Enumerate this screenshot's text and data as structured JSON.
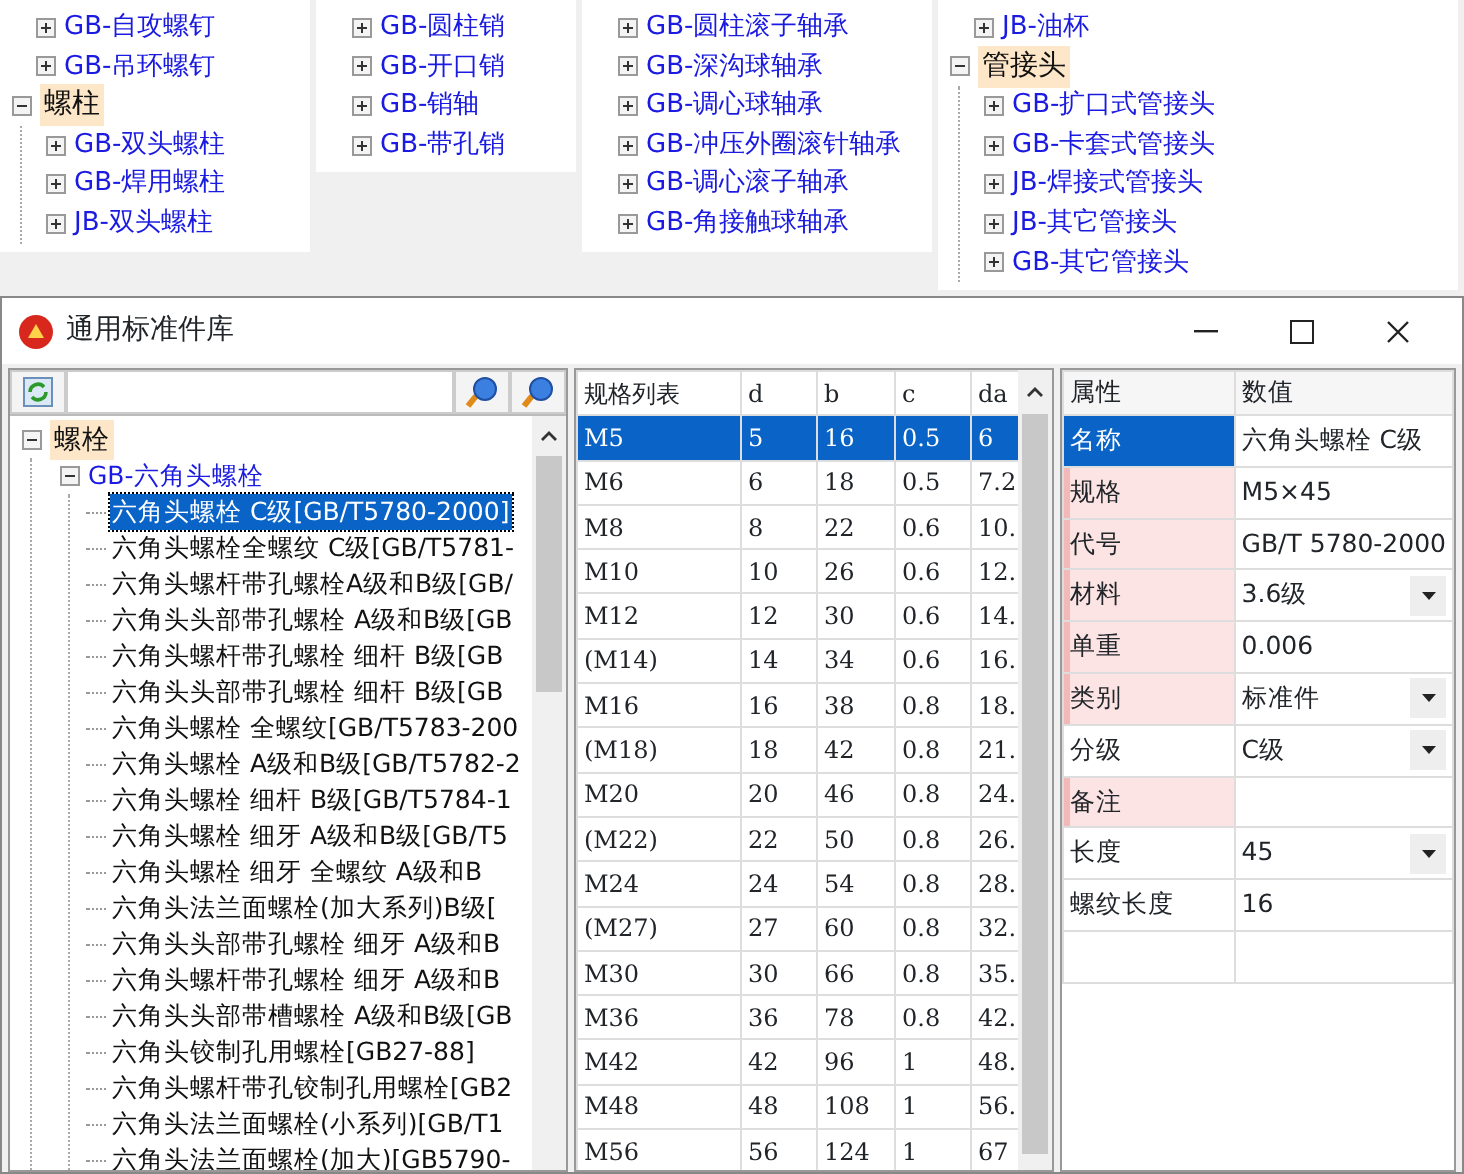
{
  "upper_trees": [
    {
      "items": [
        {
          "kind": "node",
          "label": "GB-自攻螺钉",
          "expanded": false
        },
        {
          "kind": "node",
          "label": "GB-吊环螺钉",
          "expanded": false
        },
        {
          "kind": "category",
          "label": "螺柱",
          "expanded": true,
          "children": [
            {
              "kind": "node",
              "label": "GB-双头螺柱",
              "expanded": false
            },
            {
              "kind": "node",
              "label": "GB-焊用螺柱",
              "expanded": false
            },
            {
              "kind": "node",
              "label": "JB-双头螺柱",
              "expanded": false
            }
          ]
        }
      ]
    },
    {
      "items": [
        {
          "kind": "node",
          "label": "GB-圆柱销",
          "expanded": false
        },
        {
          "kind": "node",
          "label": "GB-开口销",
          "expanded": false
        },
        {
          "kind": "node",
          "label": "GB-销轴",
          "expanded": false
        },
        {
          "kind": "node",
          "label": "GB-带孔销",
          "expanded": false
        }
      ]
    },
    {
      "items": [
        {
          "kind": "node",
          "label": "GB-圆柱滚子轴承",
          "expanded": false
        },
        {
          "kind": "node",
          "label": "GB-深沟球轴承",
          "expanded": false
        },
        {
          "kind": "node",
          "label": "GB-调心球轴承",
          "expanded": false
        },
        {
          "kind": "node",
          "label": "GB-冲压外圈滚针轴承",
          "expanded": false
        },
        {
          "kind": "node",
          "label": "GB-调心滚子轴承",
          "expanded": false
        },
        {
          "kind": "node",
          "label": "GB-角接触球轴承",
          "expanded": false
        }
      ]
    },
    {
      "items": [
        {
          "kind": "node",
          "label": "JB-油杯",
          "expanded": false
        },
        {
          "kind": "category",
          "label": "管接头",
          "expanded": true,
          "children": [
            {
              "kind": "node",
              "label": "GB-扩口式管接头",
              "expanded": false
            },
            {
              "kind": "node",
              "label": "GB-卡套式管接头",
              "expanded": false
            },
            {
              "kind": "node",
              "label": "JB-焊接式管接头",
              "expanded": false
            },
            {
              "kind": "node",
              "label": "JB-其它管接头",
              "expanded": false
            },
            {
              "kind": "node",
              "label": "GB-其它管接头",
              "expanded": false
            }
          ]
        }
      ]
    }
  ],
  "window": {
    "title": "通用标准件库"
  },
  "tree": {
    "items": [
      {
        "kind": "category",
        "label": "螺栓",
        "expanded": true,
        "children": [
          {
            "kind": "node",
            "label": "GB-六角头螺栓",
            "expanded": true,
            "children": [
              {
                "kind": "leaf",
                "label": "六角头螺栓 C级[GB/T5780-2000]",
                "selected": true
              },
              {
                "kind": "leaf",
                "label": "六角头螺栓全螺纹 C级[GB/T5781-",
                "selected": false
              },
              {
                "kind": "leaf",
                "label": "六角头螺杆带孔螺栓A级和B级[GB/",
                "selected": false
              },
              {
                "kind": "leaf",
                "label": "六角头头部带孔螺栓 A级和B级[GB",
                "selected": false
              },
              {
                "kind": "leaf",
                "label": "六角头螺杆带孔螺栓 细杆 B级[GB",
                "selected": false
              },
              {
                "kind": "leaf",
                "label": "六角头头部带孔螺栓 细杆 B级[GB",
                "selected": false
              },
              {
                "kind": "leaf",
                "label": "六角头螺栓 全螺纹[GB/T5783-200",
                "selected": false
              },
              {
                "kind": "leaf",
                "label": "六角头螺栓 A级和B级[GB/T5782-2",
                "selected": false
              },
              {
                "kind": "leaf",
                "label": "六角头螺栓 细杆 B级[GB/T5784-1",
                "selected": false
              },
              {
                "kind": "leaf",
                "label": "六角头螺栓 细牙 A级和B级[GB/T5",
                "selected": false
              },
              {
                "kind": "leaf",
                "label": "六角头螺栓 细牙 全螺纹 A级和B",
                "selected": false
              },
              {
                "kind": "leaf",
                "label": "六角头法兰面螺栓(加大系列)B级[",
                "selected": false
              },
              {
                "kind": "leaf",
                "label": "六角头头部带孔螺栓 细牙 A级和B",
                "selected": false
              },
              {
                "kind": "leaf",
                "label": "六角头螺杆带孔螺栓 细牙 A级和B",
                "selected": false
              },
              {
                "kind": "leaf",
                "label": "六角头头部带槽螺栓 A级和B级[GB",
                "selected": false
              },
              {
                "kind": "leaf",
                "label": "六角头铰制孔用螺栓[GB27-88]",
                "selected": false
              },
              {
                "kind": "leaf",
                "label": "六角头螺杆带孔铰制孔用螺栓[GB2",
                "selected": false
              },
              {
                "kind": "leaf",
                "label": "六角头法兰面螺栓(小系列)[GB/T1",
                "selected": false
              },
              {
                "kind": "leaf",
                "label": "六角头法兰面螺栓(加大)[GB5790-",
                "selected": false
              }
            ]
          }
        ]
      }
    ]
  },
  "spec_table": {
    "columns": [
      "规格列表",
      "d",
      "b",
      "c",
      "da"
    ],
    "rows": [
      {
        "cells": [
          "M5",
          "5",
          "16",
          "0.5",
          "6"
        ],
        "selected": true
      },
      {
        "cells": [
          "M6",
          "6",
          "18",
          "0.5",
          "7.2"
        ],
        "selected": false
      },
      {
        "cells": [
          "M8",
          "8",
          "22",
          "0.6",
          "10."
        ],
        "selected": false
      },
      {
        "cells": [
          "M10",
          "10",
          "26",
          "0.6",
          "12."
        ],
        "selected": false
      },
      {
        "cells": [
          "M12",
          "12",
          "30",
          "0.6",
          "14."
        ],
        "selected": false
      },
      {
        "cells": [
          "(M14)",
          "14",
          "34",
          "0.6",
          "16."
        ],
        "selected": false
      },
      {
        "cells": [
          "M16",
          "16",
          "38",
          "0.8",
          "18."
        ],
        "selected": false
      },
      {
        "cells": [
          "(M18)",
          "18",
          "42",
          "0.8",
          "21."
        ],
        "selected": false
      },
      {
        "cells": [
          "M20",
          "20",
          "46",
          "0.8",
          "24."
        ],
        "selected": false
      },
      {
        "cells": [
          "(M22)",
          "22",
          "50",
          "0.8",
          "26."
        ],
        "selected": false
      },
      {
        "cells": [
          "M24",
          "24",
          "54",
          "0.8",
          "28."
        ],
        "selected": false
      },
      {
        "cells": [
          "(M27)",
          "27",
          "60",
          "0.8",
          "32."
        ],
        "selected": false
      },
      {
        "cells": [
          "M30",
          "30",
          "66",
          "0.8",
          "35."
        ],
        "selected": false
      },
      {
        "cells": [
          "M36",
          "36",
          "78",
          "0.8",
          "42."
        ],
        "selected": false
      },
      {
        "cells": [
          "M42",
          "42",
          "96",
          "1",
          "48."
        ],
        "selected": false
      },
      {
        "cells": [
          "M48",
          "48",
          "108",
          "1",
          "56."
        ],
        "selected": false
      },
      {
        "cells": [
          "M56",
          "56",
          "124",
          "1",
          "67"
        ],
        "selected": false
      }
    ]
  },
  "properties": {
    "columns": [
      "属性",
      "数值"
    ],
    "rows": [
      {
        "name": "名称",
        "value": "六角头螺栓 C级",
        "kind": "text",
        "required": false,
        "selected": true
      },
      {
        "name": "规格",
        "value": "M5×45",
        "kind": "text",
        "required": true,
        "selected": false
      },
      {
        "name": "代号",
        "value": "GB/T 5780-2000",
        "kind": "text",
        "required": true,
        "selected": false
      },
      {
        "name": "材料",
        "value": "3.6级",
        "kind": "dropdown",
        "required": true,
        "selected": false
      },
      {
        "name": "单重",
        "value": "0.006",
        "kind": "text",
        "required": true,
        "selected": false
      },
      {
        "name": "类别",
        "value": "标准件",
        "kind": "dropdown",
        "required": true,
        "selected": false
      },
      {
        "name": "分级",
        "value": "C级",
        "kind": "dropdown",
        "required": false,
        "selected": false
      },
      {
        "name": "备注",
        "kind": "text",
        "required": true,
        "selected": false
      },
      {
        "name": "长度",
        "value": "45",
        "kind": "dropdown",
        "required": false,
        "selected": false
      },
      {
        "name": "螺纹长度",
        "value": "16",
        "kind": "text",
        "required": false,
        "selected": false
      }
    ]
  }
}
